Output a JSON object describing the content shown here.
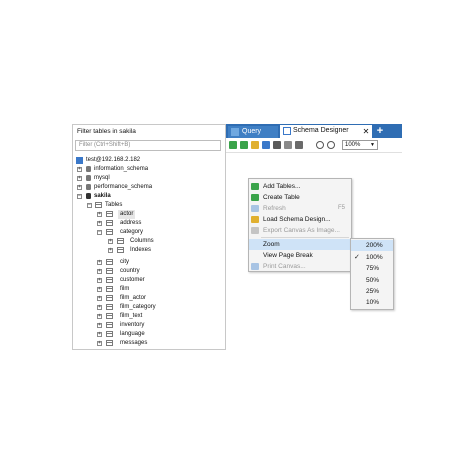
{
  "left_panel": {
    "filter_label": "Filter tables in sakila",
    "filter_placeholder": "Filter (Ctrl+Shift+B)",
    "tree": {
      "server": "test@192.168.2.182",
      "databases": [
        "information_schema",
        "mysql",
        "performance_schema",
        "sakila"
      ],
      "tables_label": "Tables",
      "tables": [
        "actor",
        "address",
        "category",
        "city",
        "country",
        "customer",
        "film",
        "film_actor",
        "film_category",
        "film_text",
        "inventory",
        "language",
        "messages"
      ],
      "category_children": [
        "Columns",
        "Indexes"
      ]
    }
  },
  "tabs": {
    "query": "Query",
    "schema_designer": "Schema Designer",
    "close": "✕",
    "add": "+"
  },
  "toolbar": {
    "zoom_value": "100%"
  },
  "context_menu": {
    "items": [
      {
        "label": "Add Tables...",
        "shortcut": ""
      },
      {
        "label": "Create Table",
        "shortcut": ""
      },
      {
        "label": "Refresh",
        "shortcut": "F5"
      },
      {
        "label": "Load Schema Design...",
        "shortcut": ""
      },
      {
        "label": "Export Canvas As Image...",
        "shortcut": ""
      },
      {
        "label": "Zoom",
        "shortcut": ""
      },
      {
        "label": "View Page Break",
        "shortcut": ""
      },
      {
        "label": "Print Canvas...",
        "shortcut": ""
      }
    ]
  },
  "zoom_submenu": {
    "items": [
      "200%",
      "100%",
      "75%",
      "50%",
      "25%",
      "10%"
    ],
    "checked": "100%"
  },
  "colors": {
    "tabbar": "#2f6db3",
    "highlight": "#cfe3f7",
    "icon_green": "#3aa34a",
    "icon_blue": "#3a78c9"
  }
}
